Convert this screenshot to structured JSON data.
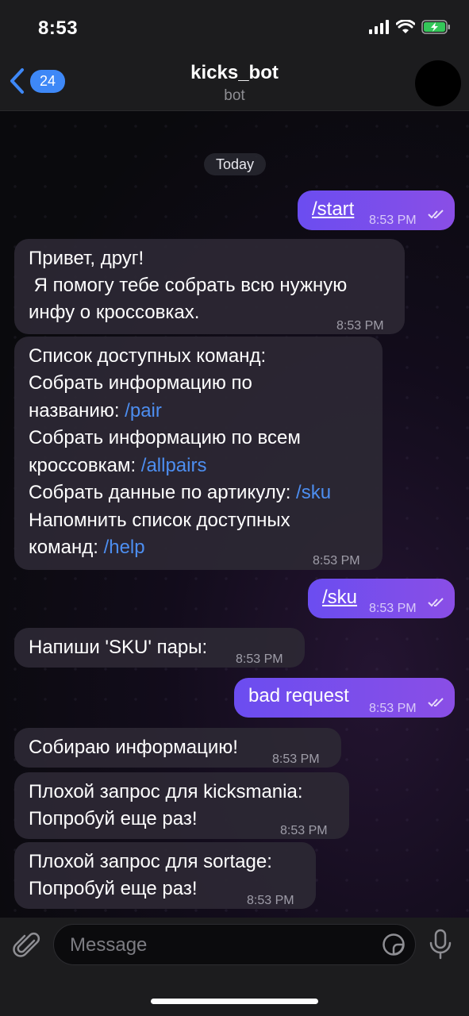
{
  "status_bar": {
    "time": "8:53"
  },
  "header": {
    "back_count": "24",
    "title": "kicks_bot",
    "subtitle": "bot"
  },
  "chat": {
    "date_label": "Today",
    "messages": [
      {
        "direction": "out",
        "lines": [
          "/start"
        ],
        "time": "8:53 PM",
        "read": true
      },
      {
        "direction": "in",
        "lines": [
          "Привет, друг!",
          " Я помогу тебе собрать всю нужную",
          "инфу о кроссовках."
        ],
        "time": "8:53 PM"
      },
      {
        "direction": "in",
        "lines": [
          "Список доступных команд:",
          "Собрать информацию по",
          "названию: ",
          "Собрать информацию по всем",
          "кроссовкам: ",
          "Собрать данные по артикулу: ",
          "Напомнить список доступных",
          "команд: "
        ],
        "links": [
          "/pair",
          "/allpairs",
          "/sku",
          "/help"
        ],
        "time": "8:53 PM"
      },
      {
        "direction": "out",
        "lines": [
          "/sku"
        ],
        "time": "8:53 PM",
        "read": true
      },
      {
        "direction": "in",
        "lines": [
          "Напиши 'SKU' пары:"
        ],
        "time": "8:53 PM"
      },
      {
        "direction": "out",
        "lines": [
          "bad request"
        ],
        "time": "8:53 PM",
        "read": true
      },
      {
        "direction": "in",
        "lines": [
          "Собираю информацию!"
        ],
        "time": "8:53 PM"
      },
      {
        "direction": "in",
        "lines": [
          "Плохой запрос для kicksmania:",
          "Попробуй еще раз!"
        ],
        "time": "8:53 PM"
      },
      {
        "direction": "in",
        "lines": [
          "Плохой запрос для sortage:",
          "Попробуй еще раз!"
        ],
        "time": "8:53 PM"
      }
    ]
  },
  "input": {
    "placeholder": "Message"
  },
  "colors": {
    "accent": "#3e88f7",
    "outgoing_start": "#6b4df0",
    "outgoing_end": "#8a4ee6",
    "incoming": "#2c2834",
    "link": "#4d8ef0"
  },
  "icons": [
    "signal-icon",
    "wifi-icon",
    "battery-charging-icon",
    "chevron-left-icon",
    "paperclip-icon",
    "sticker-icon",
    "microphone-icon",
    "double-check-icon"
  ]
}
